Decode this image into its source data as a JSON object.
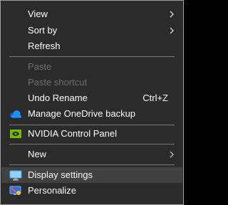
{
  "menu": {
    "view": "View",
    "sort_by": "Sort by",
    "refresh": "Refresh",
    "paste": "Paste",
    "paste_shortcut": "Paste shortcut",
    "undo_rename": "Undo Rename",
    "undo_shortcut": "Ctrl+Z",
    "onedrive": "Manage OneDrive backup",
    "nvidia": "NVIDIA Control Panel",
    "new": "New",
    "display_settings": "Display settings",
    "personalize": "Personalize"
  },
  "icons": {
    "onedrive": "cloud-icon",
    "nvidia": "nvidia-icon",
    "display": "monitor-icon",
    "personalize": "personalize-icon",
    "submenu": "chevron-right-icon"
  },
  "colors": {
    "background": "#2b2b2b",
    "text": "#ffffff",
    "disabled_text": "#6f6f6f",
    "highlight": "#414141",
    "border": "#a0a0a0"
  }
}
